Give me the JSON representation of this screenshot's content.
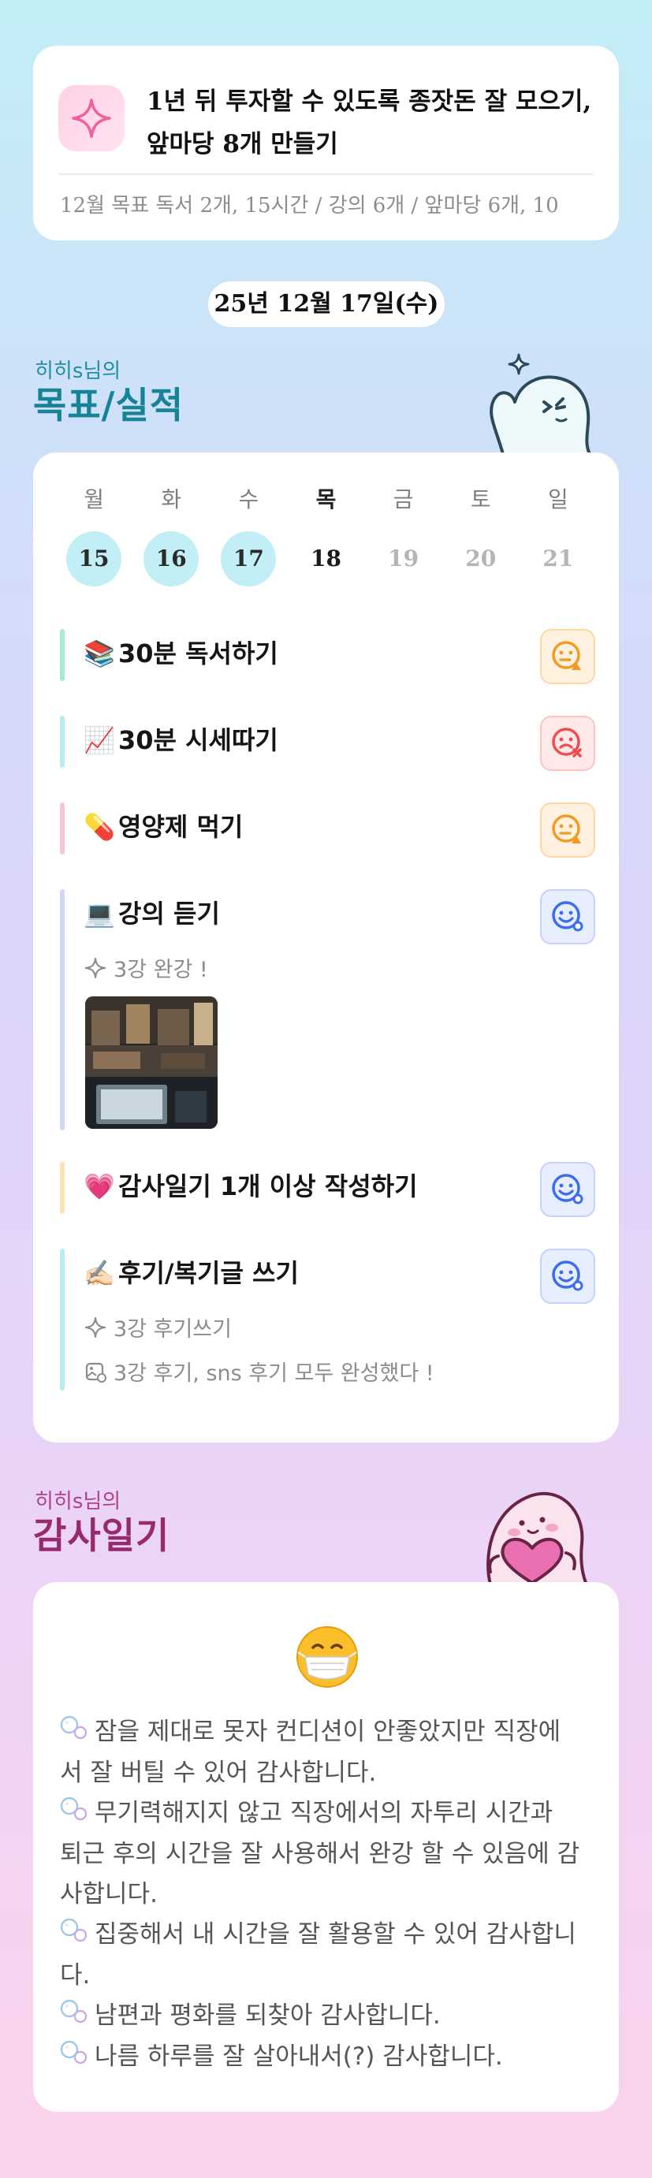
{
  "goal": {
    "title_line1": "1년 뒤 투자할 수 있도록 종잣돈 잘 모으기,",
    "title_line2": "앞마당 8개 만들기",
    "monthly": "12월 목표  독서 2개, 15시간 / 강의 6개 / 앞마당 6개, 10"
  },
  "date_label": "25년 12월 17일(수)",
  "section_goals": {
    "owner": "히히s님의",
    "title": "목표/실적"
  },
  "week": [
    {
      "name": "월",
      "num": "15",
      "status": "done"
    },
    {
      "name": "화",
      "num": "16",
      "status": "done"
    },
    {
      "name": "수",
      "num": "17",
      "status": "done"
    },
    {
      "name": "목",
      "num": "18",
      "status": "today"
    },
    {
      "name": "금",
      "num": "19",
      "status": "future"
    },
    {
      "name": "토",
      "num": "20",
      "status": "future"
    },
    {
      "name": "일",
      "num": "21",
      "status": "future"
    }
  ],
  "tasks": [
    {
      "emoji": "📚",
      "label": "30분 독서하기",
      "mood": "orange",
      "bar_color": "#a6ead6"
    },
    {
      "emoji": "📈",
      "label": "30분 시세따기",
      "mood": "red",
      "bar_color": "#b7ecf3"
    },
    {
      "emoji": "💊",
      "label": "영양제 먹기",
      "mood": "orange",
      "bar_color": "#f8c4dc"
    },
    {
      "emoji": "💻",
      "label": "강의 듣기",
      "mood": "blue",
      "bar_color": "#cfd8f5",
      "note": "3강 완강 !"
    },
    {
      "emoji": "💗",
      "label": "감사일기 1개 이상 작성하기",
      "mood": "blue",
      "bar_color": "#fde3b4"
    },
    {
      "emoji": "✍🏻",
      "label": "후기/복기글 쓰기",
      "mood": "blue",
      "bar_color": "#b7ecf3",
      "note": "3강 후기쓰기",
      "note2": "3강 후기, sns 후기 모두 완성했다 !"
    }
  ],
  "section_thanks": {
    "owner": "히히s님의",
    "title": "감사일기"
  },
  "thanks_emoji": "😷",
  "thanks": [
    "잠을 제대로 못자 컨디션이 안좋았지만 직장에",
    "서 잘 버틸 수 있어 감사합니다.",
    "무기력해지지 않고 직장에서의 자투리 시간과",
    "퇴근 후의 시간을 잘 사용해서 완강 할 수 있음에 감",
    "사합니다.",
    "집중해서 내 시간을 잘 활용할 수 있어 감사합니",
    "다.",
    "남편과 평화를 되찾아 감사합니다.",
    "나름 하루를 잘 살아내서(?) 감사합니다."
  ]
}
